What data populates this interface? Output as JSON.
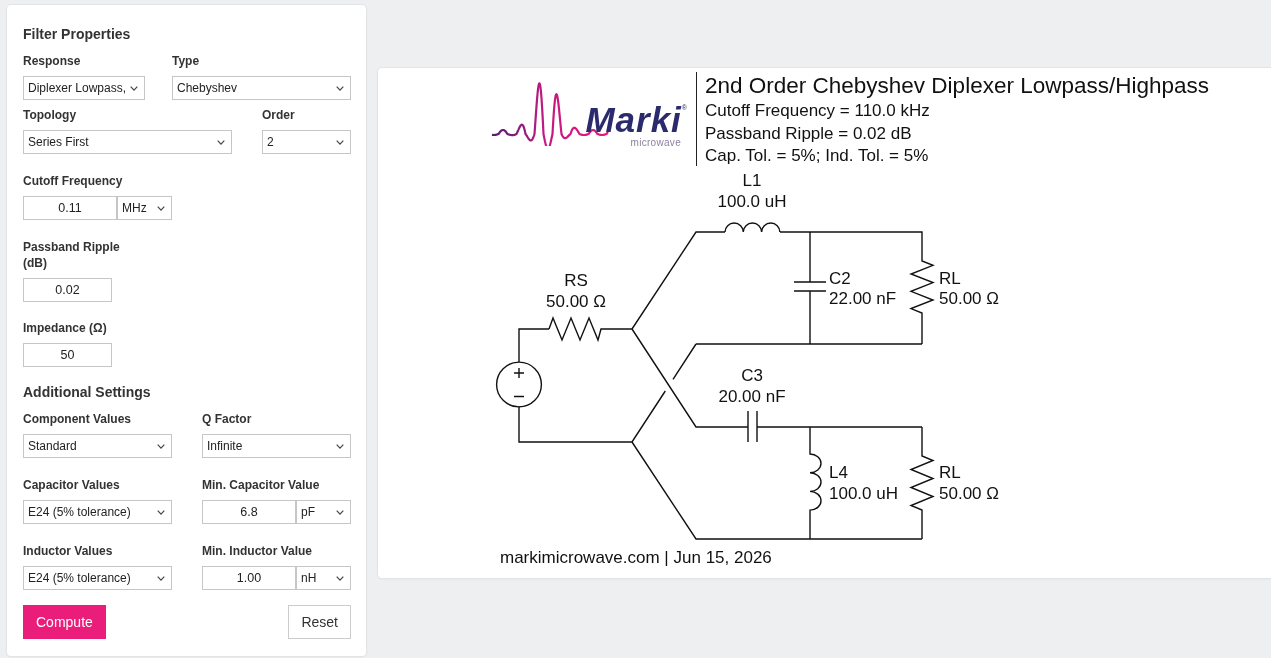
{
  "filter_panel": {
    "sections": [
      {
        "title": "Filter Properties",
        "rows": [
          [
            {
              "kind": "select",
              "label": "Response",
              "value": "Diplexer Lowpass,"
            },
            {
              "kind": "select",
              "label": "Type",
              "value": "Chebyshev"
            }
          ],
          [
            {
              "kind": "select",
              "label": "Topology",
              "value": "Series First"
            },
            {
              "kind": "select",
              "label": "Order",
              "value": "2"
            }
          ],
          [
            {
              "kind": "number_unit",
              "label": "Cutoff Frequency",
              "value": "0.11",
              "unit": "MHz"
            }
          ],
          [
            {
              "kind": "number",
              "label": "Passband Ripple (dB)",
              "value": "0.02"
            }
          ],
          [
            {
              "kind": "number",
              "label": "Impedance (Ω)",
              "value": "50"
            }
          ]
        ]
      },
      {
        "title": "Additional Settings",
        "rows": [
          [
            {
              "kind": "select",
              "label": "Component Values",
              "value": "Standard"
            },
            {
              "kind": "select",
              "label": "Q Factor",
              "value": "Infinite"
            }
          ],
          [
            {
              "kind": "select",
              "label": "Capacitor Values",
              "value": "E24 (5% tolerance)"
            },
            {
              "kind": "number_unit",
              "label": "Min. Capacitor Value",
              "value": "6.8",
              "unit": "pF"
            }
          ],
          [
            {
              "kind": "select",
              "label": "Inductor Values",
              "value": "E24 (5% tolerance)"
            },
            {
              "kind": "number_unit",
              "label": "Min. Inductor Value",
              "value": "1.00",
              "unit": "nH"
            }
          ]
        ]
      }
    ],
    "buttons": [
      {
        "kind": "primary",
        "label": "Compute"
      },
      {
        "kind": "secondary",
        "label": "Reset"
      }
    ]
  },
  "schematic": {
    "logo": {
      "wordmark": "Marki$^{®}$",
      "tagline": "microwave"
    },
    "title": "2nd Order Chebyshev Diplexer Lowpass/Highpass",
    "details": [
      "Cutoff Frequency = 110.0 kHz",
      "Passband Ripple = 0.02 dB",
      "Cap. Tol. = 5%; Ind. Tol. = 5%"
    ],
    "components": [
      {
        "ref": "L1",
        "value": "100.0 uH"
      },
      {
        "ref": "RS",
        "value": "50.00 Ω"
      },
      {
        "ref": "C2",
        "value": "22.00 nF"
      },
      {
        "ref": "RL",
        "value": "50.00 Ω"
      },
      {
        "ref": "C3",
        "value": "20.00 nF"
      },
      {
        "ref": "L4",
        "value": "100.0 uH"
      },
      {
        "ref": "RL",
        "value": "50.00 Ω"
      }
    ],
    "footer": "markimicrowave.com | Jun 15, 2026"
  }
}
